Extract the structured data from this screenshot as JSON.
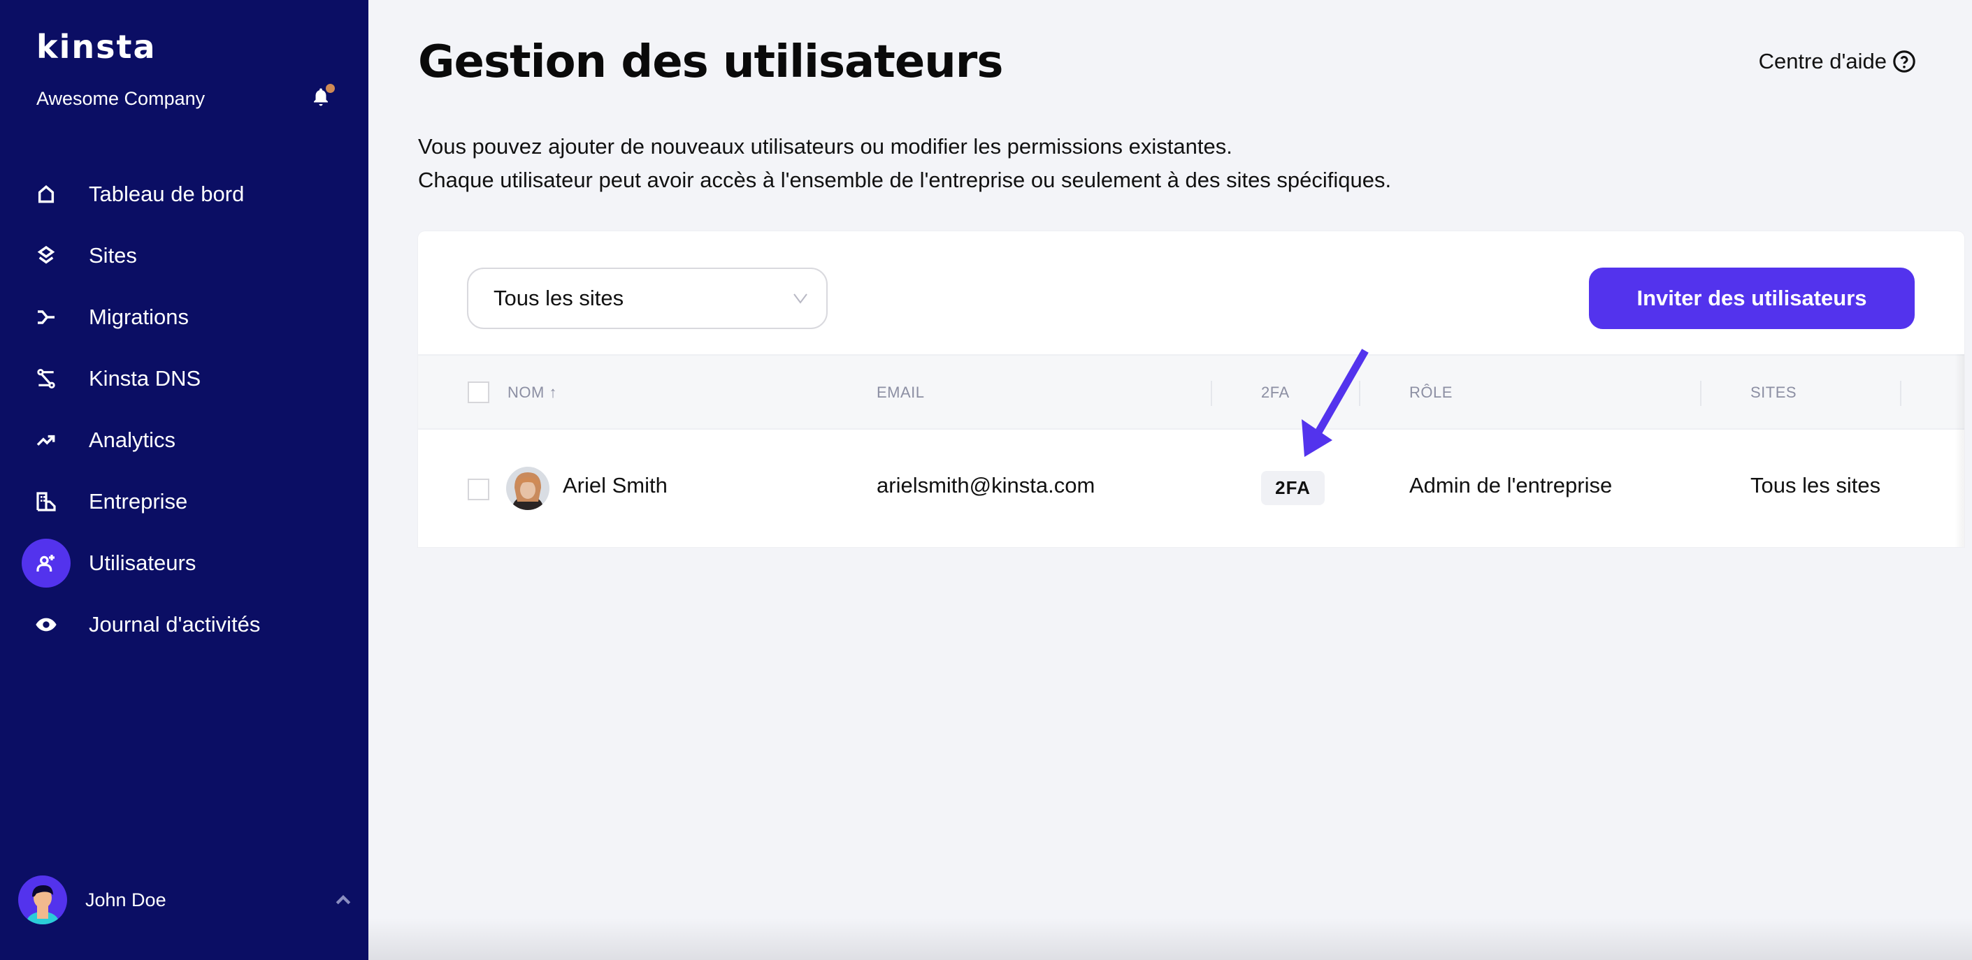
{
  "sidebar": {
    "logo": "KINSTA",
    "company": "Awesome Company",
    "notification_icon": "bell-icon",
    "items": [
      {
        "label": "Tableau de bord",
        "icon": "home-icon",
        "active": false
      },
      {
        "label": "Sites",
        "icon": "layers-icon",
        "active": false
      },
      {
        "label": "Migrations",
        "icon": "migrations-icon",
        "active": false
      },
      {
        "label": "Kinsta DNS",
        "icon": "dns-icon",
        "active": false
      },
      {
        "label": "Analytics",
        "icon": "trend-icon",
        "active": false
      },
      {
        "label": "Entreprise",
        "icon": "building-icon",
        "active": false
      },
      {
        "label": "Utilisateurs",
        "icon": "user-plus-icon",
        "active": true
      },
      {
        "label": "Journal d'activités",
        "icon": "eye-icon",
        "active": false
      }
    ],
    "user": {
      "name": "John Doe",
      "chevron": "chevron-up-icon"
    }
  },
  "header": {
    "title": "Gestion des utilisateurs",
    "help_label": "Centre d'aide",
    "description_line1": "Vous pouvez ajouter de nouveaux utilisateurs ou modifier les permissions existantes.",
    "description_line2": "Chaque utilisateur peut avoir accès à l'ensemble de l'entreprise ou seulement à des sites spécifiques."
  },
  "toolbar": {
    "site_filter": "Tous les sites",
    "invite_label": "Inviter des utilisateurs"
  },
  "table": {
    "columns": [
      "NOM ↑",
      "EMAIL",
      "2FA",
      "RÔLE",
      "SITES"
    ],
    "rows": [
      {
        "name": "Ariel Smith",
        "email": "arielsmith@kinsta.com",
        "twofa": "2FA",
        "role": "Admin de l'entreprise",
        "sites": "Tous les sites"
      }
    ]
  },
  "colors": {
    "sidebar_bg": "#0b0e64",
    "accent": "#5333ed",
    "notification_dot": "#d08a55",
    "page_bg": "#f3f4f8"
  }
}
